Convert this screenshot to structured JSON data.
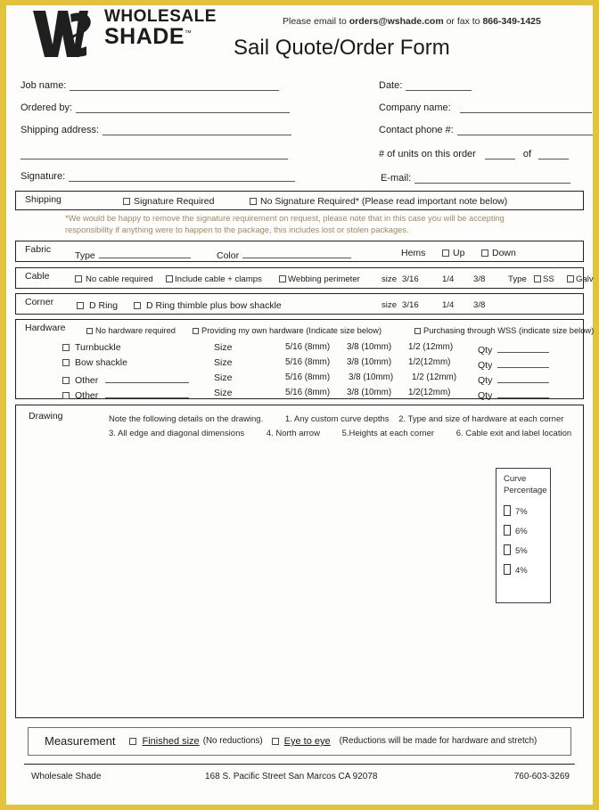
{
  "header": {
    "logo_line1": "WHOLESALE",
    "logo_line2": "SHADE",
    "logo_tm": "™",
    "contact_prefix": "Please email to ",
    "contact_email": "orders@wshade.com",
    "contact_middle": " or fax to ",
    "contact_fax": "866-349-1425",
    "title": "Sail Quote/Order Form"
  },
  "fields": {
    "job_name": "Job name:",
    "ordered_by": "Ordered by:",
    "shipping_address": "Shipping address:",
    "signature": "Signature:",
    "date": "Date:",
    "company_name": "Company name:",
    "contact_phone": "Contact phone #:",
    "units_label": "# of units on this order",
    "units_of": "of",
    "email": "E-mail:"
  },
  "shipping": {
    "title": "Shipping",
    "opt_signature_required": "Signature Required",
    "opt_no_signature_required": "No Signature Required* (Please read important note below)",
    "note_line1": "*We would be happy to remove the signature requirement on request, please note that in this case you will be accepting",
    "note_line2": "responsibility if anything were to happen to the package, this includes lost or stolen packages.",
    "note_color": "#a08a62"
  },
  "fabric": {
    "title": "Fabric",
    "type_label": "Type",
    "color_label": "Color",
    "hems_label": "Hems",
    "hems_up": "Up",
    "hems_down": "Down"
  },
  "cable": {
    "title": "Cable",
    "opt_no_cable": "No cable required",
    "opt_include_cable": "Include cable + clamps",
    "opt_webbing": "Webbing perimeter",
    "size_label": "size",
    "sizes": [
      "3/16",
      "1/4",
      "3/8"
    ],
    "type_label": "Type",
    "type_ss": "SS",
    "type_galv": "Galv"
  },
  "corner": {
    "title": "Corner",
    "opt_d_ring": "D Ring",
    "opt_d_ring_thimble": "D Ring thimble plus bow shackle",
    "size_label": "size",
    "sizes": [
      "3/16",
      "1/4",
      "3/8"
    ]
  },
  "hardware": {
    "title": "Hardware",
    "opt_no_hardware": "No hardware required",
    "opt_own_hardware": "Providing my own hardware (Indicate size below)",
    "opt_purchase_wss": "Purchasing through WSS (indicate size below)",
    "size_label": "Size",
    "qty_label": "Qty",
    "rows": [
      {
        "name": "Turnbuckle",
        "has_blank": false,
        "s1": "5/16 (8mm)",
        "s2": "3/8 (10mm)",
        "s3": "1/2 (12mm)"
      },
      {
        "name": "Bow shackle",
        "has_blank": false,
        "s1": "5/16 (8mm)",
        "s2": "3/8 (10mm)",
        "s3": "1/2(12mm)"
      },
      {
        "name": "Other",
        "has_blank": true,
        "s1": "5/16 (8mm)",
        "s2": "3/8 (10mm)",
        "s3": "1/2 (12mm)"
      },
      {
        "name": "Other",
        "has_blank": true,
        "s1": "5/16 (8mm)",
        "s2": "3/8 (10mm)",
        "s3": "1/2(12mm)"
      }
    ]
  },
  "drawing": {
    "title": "Drawing",
    "note_intro": "Note the following details on the drawing.",
    "note_1": "1. Any custom curve depths",
    "note_2": "2. Type and size of hardware at each corner",
    "note_3": "3. All edge and diagonal dimensions",
    "note_4": "4. North arrow",
    "note_5": "5.Heights at each corner",
    "note_6": "6. Cable exit and label location",
    "curve_title_line1": "Curve",
    "curve_title_line2": "Percentage",
    "curve_options": [
      "7%",
      "6%",
      "5%",
      "4%"
    ]
  },
  "measurement": {
    "title": "Measurement",
    "opt_finished_size": "Finished size",
    "finished_size_paren": "(No reductions)",
    "opt_eye_to_eye": "Eye to eye",
    "eye_to_eye_paren": "(Reductions will be made for hardware and stretch)"
  },
  "footer": {
    "company": "Wholesale Shade",
    "address": "168 S. Pacific Street San Marcos CA 92078",
    "phone": "760-603-3269"
  },
  "colors": {
    "page_border": "#e3c23c",
    "section_border": "#222222",
    "note_text": "#a08a62"
  }
}
